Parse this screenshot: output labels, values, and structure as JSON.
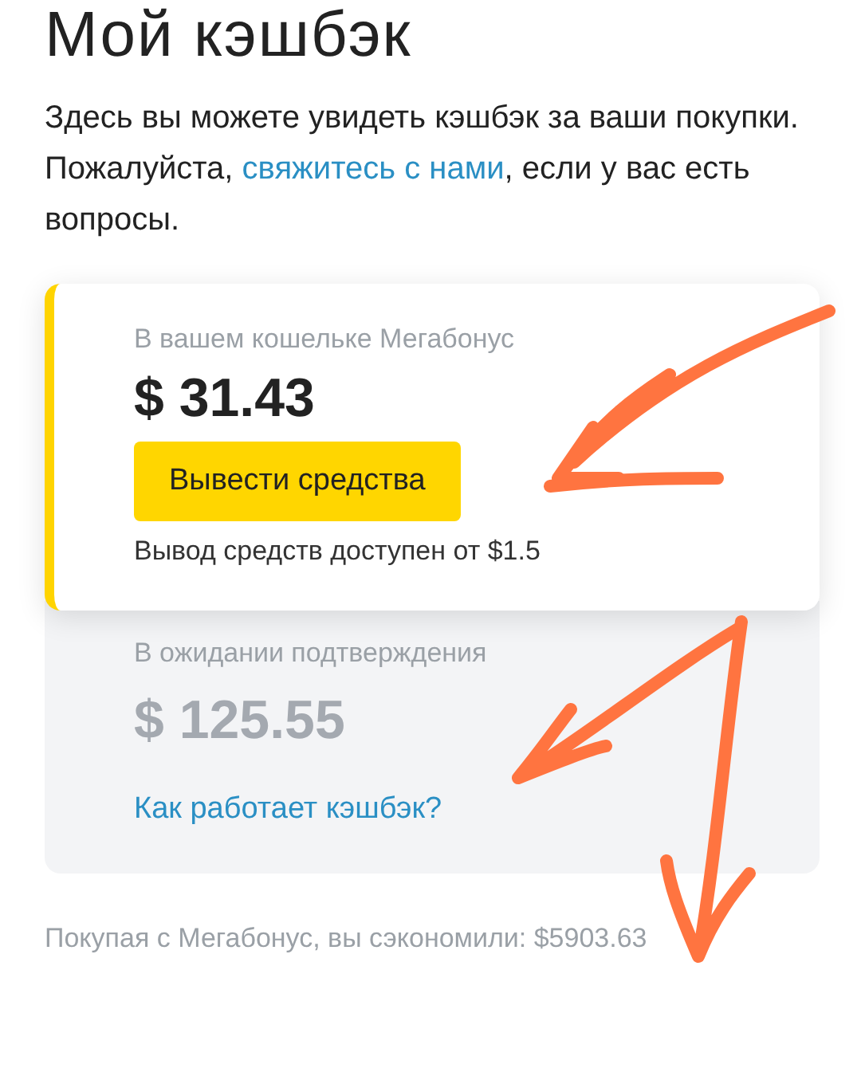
{
  "title": "Мой кэшбэк",
  "intro": {
    "before": "Здесь вы можете увидеть кэшбэк за ваши покупки. Пожалуйста, ",
    "link": "свяжитесь с нами",
    "after": ", если у вас есть вопросы."
  },
  "wallet": {
    "label": "В вашем кошельке Мегабонус",
    "amount": "$ 31.43",
    "button": "Вывести средства",
    "note": "Вывод средств доступен от $1.5"
  },
  "pending": {
    "label": "В ожидании подтверждения",
    "amount": "$ 125.55",
    "link": "Как работает кэшбэк?"
  },
  "footer": "Покупая с Мегабонус, вы сэкономили: $5903.63",
  "annotations": [
    {
      "kind": "arrow"
    },
    {
      "kind": "arrow"
    },
    {
      "kind": "arrow"
    }
  ]
}
